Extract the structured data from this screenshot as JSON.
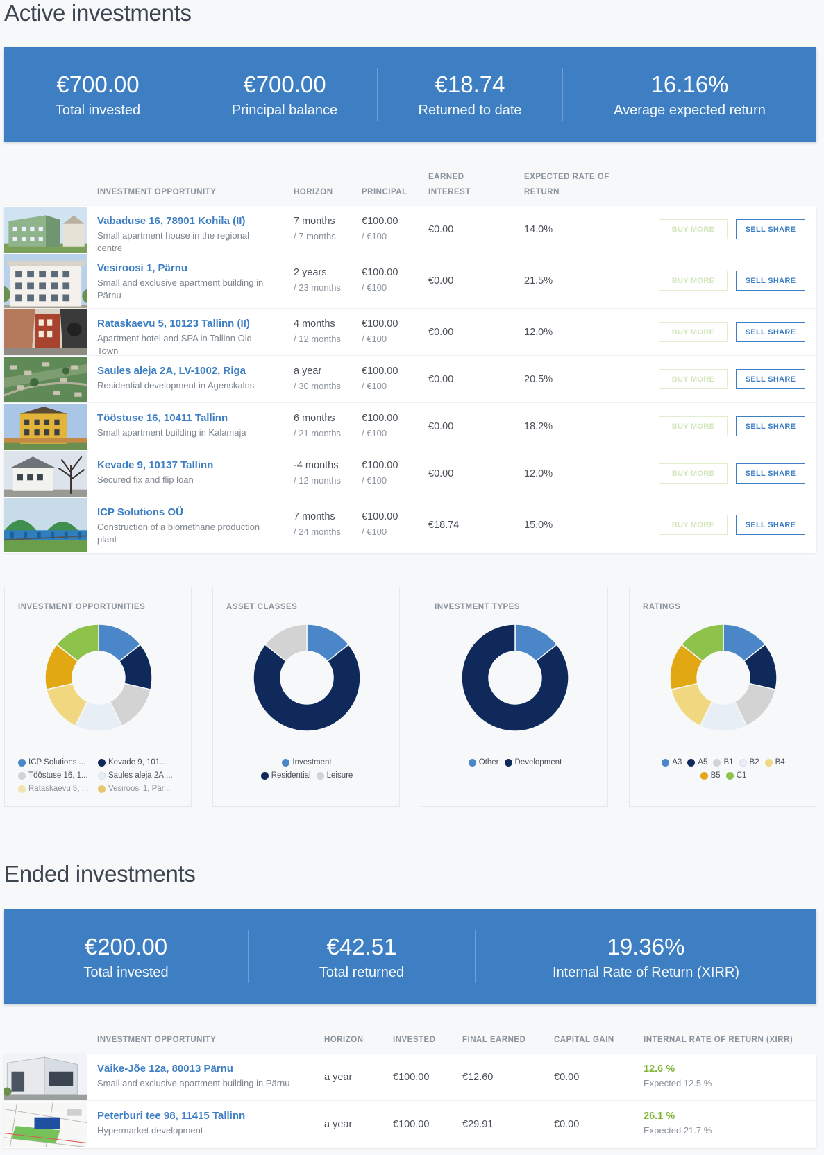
{
  "active": {
    "title": "Active investments",
    "stats": [
      {
        "value": "€700.00",
        "label": "Total invested"
      },
      {
        "value": "€700.00",
        "label": "Principal balance"
      },
      {
        "value": "€18.74",
        "label": "Returned to date"
      },
      {
        "value": "16.16%",
        "label": "Average expected return"
      }
    ],
    "headers": {
      "opportunity": "INVESTMENT OPPORTUNITY",
      "horizon": "HORIZON",
      "principal": "PRINCIPAL",
      "earned_line1": "EARNED",
      "earned_line2": "INTEREST",
      "rate_line1": "EXPECTED RATE OF",
      "rate_line2": "RETURN"
    },
    "buy_label": "BUY MORE",
    "sell_label": "SELL SHARE",
    "rows": [
      {
        "name": "Vabaduse 16, 78901 Kohila (II)",
        "desc": "Small apartment house in the regional centre",
        "horizon": "7 months",
        "horizon_total": "/ 7 months",
        "principal": "€100.00",
        "principal_total": "/ €100",
        "earned": "€0.00",
        "rate": "14.0%",
        "thumb": "building-green-icon"
      },
      {
        "name": "Vesiroosi 1, Pärnu",
        "desc": "Small and exclusive apartment building in Pärnu",
        "horizon": "2 years",
        "horizon_total": "/ 23 months",
        "principal": "€100.00",
        "principal_total": "/ €100",
        "earned": "€0.00",
        "rate": "21.5%",
        "thumb": "building-white-icon"
      },
      {
        "name": "Rataskaevu 5, 10123 Tallinn (II)",
        "desc": "Apartment hotel and SPA in Tallinn Old Town",
        "horizon": "4 months",
        "horizon_total": "/ 12 months",
        "principal": "€100.00",
        "principal_total": "/ €100",
        "earned": "€0.00",
        "rate": "12.0%",
        "thumb": "old-town-street-icon"
      },
      {
        "name": "Saules aleja 2A, LV-1002, Riga",
        "desc": "Residential development in Agenskalns",
        "horizon": "a year",
        "horizon_total": "/ 30 months",
        "principal": "€100.00",
        "principal_total": "/ €100",
        "earned": "€0.00",
        "rate": "20.5%",
        "thumb": "aerial-view-icon"
      },
      {
        "name": "Tööstuse 16, 10411 Tallinn",
        "desc": "Small apartment building in Kalamaja",
        "horizon": "6 months",
        "horizon_total": "/ 21 months",
        "principal": "€100.00",
        "principal_total": "/ €100",
        "earned": "€0.00",
        "rate": "18.2%",
        "thumb": "building-yellow-icon"
      },
      {
        "name": "Kevade 9, 10137 Tallinn",
        "desc": "Secured fix and flip loan",
        "horizon": "-4 months",
        "horizon_total": "/ 12 months",
        "principal": "€100.00",
        "principal_total": "/ €100",
        "earned": "€0.00",
        "rate": "12.0%",
        "thumb": "house-tree-icon"
      },
      {
        "name": "ICP Solutions OÜ",
        "desc": "Construction of a biomethane production plant",
        "horizon": "7 months",
        "horizon_total": "/ 24 months",
        "principal": "€100.00",
        "principal_total": "/ €100",
        "earned": "€18.74",
        "rate": "15.0%",
        "thumb": "biomethane-plant-icon"
      }
    ]
  },
  "charts": {
    "colors": {
      "blue": "#4a86c8",
      "navy": "#0f2a5a",
      "lightgray": "#d3d3d3",
      "pale": "#e8eef6",
      "sand": "#f1d780",
      "gold": "#e2a814",
      "green": "#8dc34a"
    },
    "opportunities": {
      "title": "INVESTMENT OPPORTUNITIES",
      "legend": [
        {
          "label": "ICP Solutions ...",
          "color": "#4a86c8"
        },
        {
          "label": "Kevade 9, 101...",
          "color": "#0f2a5a"
        },
        {
          "label": "Tööstuse 16, 1...",
          "color": "#d3d3d3"
        },
        {
          "label": "Saules aleja 2A,...",
          "color": "#e8eef6"
        },
        {
          "label": "Rataskaevu 5, ...",
          "color": "#f1d780"
        },
        {
          "label": "Vesiroosi 1, Pär...",
          "color": "#e2a814"
        }
      ],
      "slices": [
        {
          "color": "#4a86c8",
          "value": 1
        },
        {
          "color": "#0f2a5a",
          "value": 1
        },
        {
          "color": "#d3d3d3",
          "value": 1
        },
        {
          "color": "#e8eef6",
          "value": 1
        },
        {
          "color": "#f1d780",
          "value": 1
        },
        {
          "color": "#e2a814",
          "value": 1
        },
        {
          "color": "#8dc34a",
          "value": 1
        }
      ]
    },
    "asset_classes": {
      "title": "ASSET CLASSES",
      "legend": [
        {
          "label": "Investment",
          "color": "#4a86c8"
        },
        {
          "label": "Residential",
          "color": "#0f2a5a"
        },
        {
          "label": "Leisure",
          "color": "#d3d3d3"
        }
      ],
      "slices": [
        {
          "color": "#4a86c8",
          "value": 1
        },
        {
          "color": "#0f2a5a",
          "value": 5
        },
        {
          "color": "#d3d3d3",
          "value": 1
        }
      ]
    },
    "investment_types": {
      "title": "INVESTMENT TYPES",
      "legend": [
        {
          "label": "Other",
          "color": "#4a86c8"
        },
        {
          "label": "Development",
          "color": "#0f2a5a"
        }
      ],
      "slices": [
        {
          "color": "#4a86c8",
          "value": 1
        },
        {
          "color": "#0f2a5a",
          "value": 6
        }
      ]
    },
    "ratings": {
      "title": "RATINGS",
      "legend": [
        {
          "label": "A3",
          "color": "#4a86c8"
        },
        {
          "label": "A5",
          "color": "#0f2a5a"
        },
        {
          "label": "B1",
          "color": "#d3d3d3"
        },
        {
          "label": "B2",
          "color": "#e8eef6"
        },
        {
          "label": "B4",
          "color": "#f1d780"
        },
        {
          "label": "B5",
          "color": "#e2a814"
        },
        {
          "label": "C1",
          "color": "#8dc34a"
        }
      ],
      "slices": [
        {
          "color": "#4a86c8",
          "value": 1
        },
        {
          "color": "#0f2a5a",
          "value": 1
        },
        {
          "color": "#d3d3d3",
          "value": 1
        },
        {
          "color": "#e8eef6",
          "value": 1
        },
        {
          "color": "#f1d780",
          "value": 1
        },
        {
          "color": "#e2a814",
          "value": 1
        },
        {
          "color": "#8dc34a",
          "value": 1
        }
      ]
    }
  },
  "ended": {
    "title": "Ended investments",
    "stats": [
      {
        "value": "€200.00",
        "label": "Total invested"
      },
      {
        "value": "€42.51",
        "label": "Total returned"
      },
      {
        "value": "19.36%",
        "label": "Internal Rate of Return (XIRR)"
      }
    ],
    "headers": {
      "opportunity": "INVESTMENT OPPORTUNITY",
      "horizon": "HORIZON",
      "invested": "INVESTED",
      "final_earned": "FINAL EARNED",
      "capital_gain": "CAPITAL GAIN",
      "xirr": "INTERNAL RATE OF RETURN (XIRR)"
    },
    "rows": [
      {
        "name": "Väike-Jõe 12a, 80013 Pärnu",
        "desc": "Small and exclusive apartment building in Pärnu",
        "horizon": "a year",
        "invested": "€100.00",
        "final_earned": "€12.60",
        "capital_gain": "€0.00",
        "xirr": "12.6 %",
        "expected": "Expected 12.5 %",
        "thumb": "modern-building-icon"
      },
      {
        "name": "Peterburi tee 98, 11415 Tallinn",
        "desc": "Hypermarket development",
        "horizon": "a year",
        "invested": "€100.00",
        "final_earned": "€29.91",
        "capital_gain": "€0.00",
        "xirr": "26.1 %",
        "expected": "Expected 21.7 %",
        "thumb": "site-plan-icon"
      }
    ]
  }
}
